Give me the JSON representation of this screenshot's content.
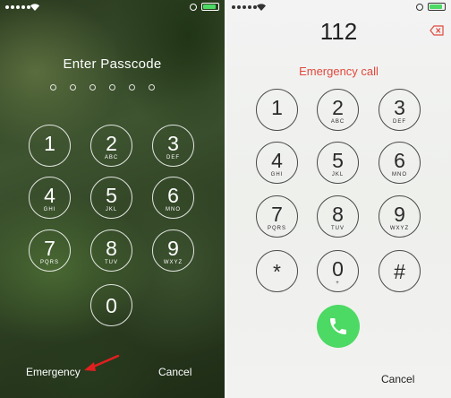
{
  "left": {
    "title": "Enter Passcode",
    "keys": [
      {
        "digit": "1",
        "letters": ""
      },
      {
        "digit": "2",
        "letters": "ABC"
      },
      {
        "digit": "3",
        "letters": "DEF"
      },
      {
        "digit": "4",
        "letters": "GHI"
      },
      {
        "digit": "5",
        "letters": "JKL"
      },
      {
        "digit": "6",
        "letters": "MNO"
      },
      {
        "digit": "7",
        "letters": "PQRS"
      },
      {
        "digit": "8",
        "letters": "TUV"
      },
      {
        "digit": "9",
        "letters": "WXYZ"
      },
      {
        "digit": "0",
        "letters": ""
      }
    ],
    "emergency_label": "Emergency",
    "cancel_label": "Cancel"
  },
  "right": {
    "typed_number": "112",
    "status": "Emergency call",
    "keys": [
      {
        "digit": "1",
        "letters": ""
      },
      {
        "digit": "2",
        "letters": "ABC"
      },
      {
        "digit": "3",
        "letters": "DEF"
      },
      {
        "digit": "4",
        "letters": "GHI"
      },
      {
        "digit": "5",
        "letters": "JKL"
      },
      {
        "digit": "6",
        "letters": "MNO"
      },
      {
        "digit": "7",
        "letters": "PQRS"
      },
      {
        "digit": "8",
        "letters": "TUV"
      },
      {
        "digit": "9",
        "letters": "WXYZ"
      },
      {
        "digit": "*",
        "letters": ""
      },
      {
        "digit": "0",
        "letters": "+"
      },
      {
        "digit": "#",
        "letters": ""
      }
    ],
    "cancel_label": "Cancel"
  },
  "colors": {
    "emergency_red": "#e0483d",
    "call_green": "#4cd964",
    "battery_green": "#4cd964",
    "arrow_red": "#e02020"
  }
}
